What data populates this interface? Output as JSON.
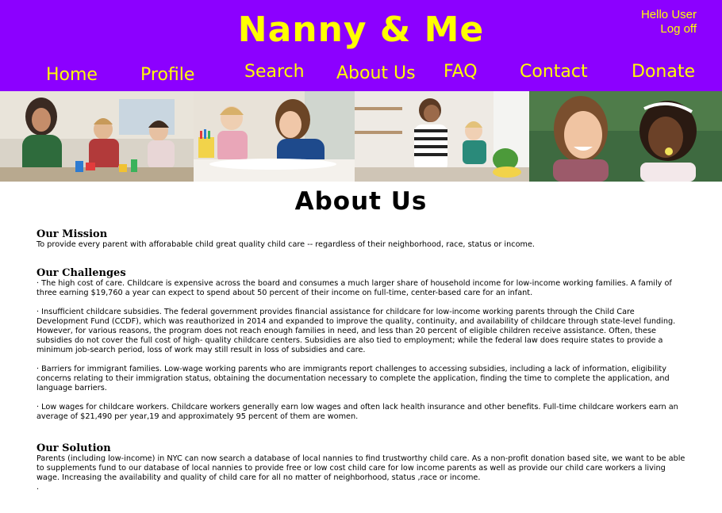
{
  "header": {
    "site_title": "Nanny & Me",
    "greeting": "Hello User",
    "logoff": "Log off",
    "nav": [
      "Home",
      "Profile",
      "Search",
      "About Us",
      "FAQ",
      "Contact",
      "Donate"
    ]
  },
  "colors": {
    "header_bg": "#8c00ff",
    "header_text": "#ffff00"
  },
  "photos": [
    "mother and two children playing with toys",
    "woman and toddler drawing at table",
    "woman and child cooking in kitchen",
    "smiling woman and girl eating"
  ],
  "main": {
    "title": "About Us",
    "mission_head": "Our Mission",
    "mission_text": "To provide every parent with afforabable child great quality child care -- regardless of their neighborhood, race, status or income.",
    "challenges_head": "Our Challenges",
    "challenge_1": "· The high cost of care. Childcare is expensive across the board and consumes a much larger share of household income for low-income working families. A family of three earning $19,760 a year can expect to spend about 50 percent of their income on full-time, center-based care for an infant.",
    "challenge_2": "· Insufficient childcare subsidies. The federal government provides financial assistance for childcare for low-income working parents through the Child Care Development Fund (CCDF), which was reauthorized in 2014 and expanded to improve the quality, continuity, and availability of childcare through state-level funding. However, for various reasons, the program does not reach enough families in need, and less than 20 percent of eligible children receive assistance. Often, these subsidies do not cover the full cost of high- quality childcare centers. Subsidies are also tied to employment; while the federal law does require states to provide a minimum job-search period, loss of work may still result in loss of subsidies and care.",
    "challenge_3": "· Barriers for immigrant families. Low-wage working parents who are immigrants report challenges to accessing subsidies, including a lack of information, eligibility concerns relating to their immigration status, obtaining the documentation necessary to complete the application, finding the time to complete the application, and language barriers.",
    "challenge_4": "· Low wages for childcare workers. Childcare workers generally earn low wages and often lack health insurance and other benefits. Full-time childcare workers earn an average of $21,490 per year,19 and approximately 95 percent of them are women.",
    "solution_head": "Our Solution",
    "solution_text": "Parents (including low-income) in NYC can now search a database of local nannies to find trustworthy child care.  As a non-profit donation based site, we want to be able to supplements fund to our database of local nannies to provide free or low cost child care for low income parents as well as provide our child care workers a living wage. Increasing the availability and quality of child care for all no matter of neighborhood, status ,race or income.",
    "trailing_dot": "."
  }
}
